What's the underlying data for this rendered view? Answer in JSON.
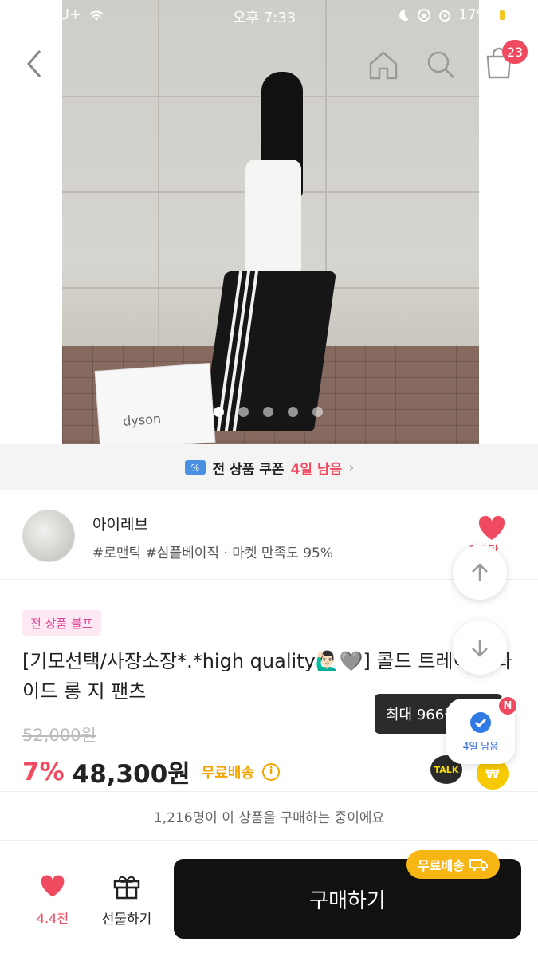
{
  "status_bar": {
    "carrier": "LG U+",
    "time": "오후 7:33",
    "battery": "17%"
  },
  "header": {
    "cart_count": "23"
  },
  "gallery": {
    "bag_text": "dyson",
    "page_count": 5,
    "active_index": 0
  },
  "coupon": {
    "title": "전 상품 쿠폰",
    "remaining": "4일 남음"
  },
  "seller": {
    "name": "아이레브",
    "meta": "#로맨틱 #심플베이직 · 마켓 만족도 95%",
    "likes": "1.3만"
  },
  "product": {
    "tag": "전 상품 블프",
    "title": "[기모선택/사장소장*.*high quality🙋🏻‍♂️🩶] 콜드 트레이닝 와이드 롱 지 팬츠",
    "original_price": "52,000원",
    "discount": "7%",
    "price": "48,300원",
    "shipping": "무료배송"
  },
  "floating": {
    "tooltip": "최대 966원",
    "coupon_label": "4일 남음",
    "new_badge": "N",
    "talk": "TALK",
    "pay": "₩"
  },
  "buyers_text": "1,216명이 이 상품을 구매하는 중이에요",
  "bottom_bar": {
    "like_count": "4.4천",
    "gift_label": "선물하기",
    "buy_label": "구매하기",
    "free_ship_badge": "무료배송"
  },
  "colors": {
    "accent": "#f04a61",
    "ship": "#f5a400",
    "dark": "#111111"
  }
}
